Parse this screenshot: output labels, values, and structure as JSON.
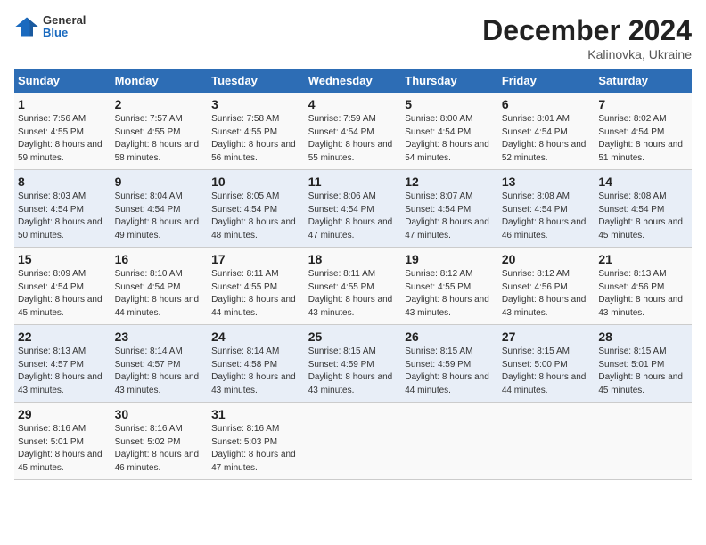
{
  "header": {
    "logo_general": "General",
    "logo_blue": "Blue",
    "month_title": "December 2024",
    "location": "Kalinovka, Ukraine"
  },
  "weekdays": [
    "Sunday",
    "Monday",
    "Tuesday",
    "Wednesday",
    "Thursday",
    "Friday",
    "Saturday"
  ],
  "weeks": [
    [
      {
        "day": "1",
        "sunrise": "Sunrise: 7:56 AM",
        "sunset": "Sunset: 4:55 PM",
        "daylight": "Daylight: 8 hours and 59 minutes."
      },
      {
        "day": "2",
        "sunrise": "Sunrise: 7:57 AM",
        "sunset": "Sunset: 4:55 PM",
        "daylight": "Daylight: 8 hours and 58 minutes."
      },
      {
        "day": "3",
        "sunrise": "Sunrise: 7:58 AM",
        "sunset": "Sunset: 4:55 PM",
        "daylight": "Daylight: 8 hours and 56 minutes."
      },
      {
        "day": "4",
        "sunrise": "Sunrise: 7:59 AM",
        "sunset": "Sunset: 4:54 PM",
        "daylight": "Daylight: 8 hours and 55 minutes."
      },
      {
        "day": "5",
        "sunrise": "Sunrise: 8:00 AM",
        "sunset": "Sunset: 4:54 PM",
        "daylight": "Daylight: 8 hours and 54 minutes."
      },
      {
        "day": "6",
        "sunrise": "Sunrise: 8:01 AM",
        "sunset": "Sunset: 4:54 PM",
        "daylight": "Daylight: 8 hours and 52 minutes."
      },
      {
        "day": "7",
        "sunrise": "Sunrise: 8:02 AM",
        "sunset": "Sunset: 4:54 PM",
        "daylight": "Daylight: 8 hours and 51 minutes."
      }
    ],
    [
      {
        "day": "8",
        "sunrise": "Sunrise: 8:03 AM",
        "sunset": "Sunset: 4:54 PM",
        "daylight": "Daylight: 8 hours and 50 minutes."
      },
      {
        "day": "9",
        "sunrise": "Sunrise: 8:04 AM",
        "sunset": "Sunset: 4:54 PM",
        "daylight": "Daylight: 8 hours and 49 minutes."
      },
      {
        "day": "10",
        "sunrise": "Sunrise: 8:05 AM",
        "sunset": "Sunset: 4:54 PM",
        "daylight": "Daylight: 8 hours and 48 minutes."
      },
      {
        "day": "11",
        "sunrise": "Sunrise: 8:06 AM",
        "sunset": "Sunset: 4:54 PM",
        "daylight": "Daylight: 8 hours and 47 minutes."
      },
      {
        "day": "12",
        "sunrise": "Sunrise: 8:07 AM",
        "sunset": "Sunset: 4:54 PM",
        "daylight": "Daylight: 8 hours and 47 minutes."
      },
      {
        "day": "13",
        "sunrise": "Sunrise: 8:08 AM",
        "sunset": "Sunset: 4:54 PM",
        "daylight": "Daylight: 8 hours and 46 minutes."
      },
      {
        "day": "14",
        "sunrise": "Sunrise: 8:08 AM",
        "sunset": "Sunset: 4:54 PM",
        "daylight": "Daylight: 8 hours and 45 minutes."
      }
    ],
    [
      {
        "day": "15",
        "sunrise": "Sunrise: 8:09 AM",
        "sunset": "Sunset: 4:54 PM",
        "daylight": "Daylight: 8 hours and 45 minutes."
      },
      {
        "day": "16",
        "sunrise": "Sunrise: 8:10 AM",
        "sunset": "Sunset: 4:54 PM",
        "daylight": "Daylight: 8 hours and 44 minutes."
      },
      {
        "day": "17",
        "sunrise": "Sunrise: 8:11 AM",
        "sunset": "Sunset: 4:55 PM",
        "daylight": "Daylight: 8 hours and 44 minutes."
      },
      {
        "day": "18",
        "sunrise": "Sunrise: 8:11 AM",
        "sunset": "Sunset: 4:55 PM",
        "daylight": "Daylight: 8 hours and 43 minutes."
      },
      {
        "day": "19",
        "sunrise": "Sunrise: 8:12 AM",
        "sunset": "Sunset: 4:55 PM",
        "daylight": "Daylight: 8 hours and 43 minutes."
      },
      {
        "day": "20",
        "sunrise": "Sunrise: 8:12 AM",
        "sunset": "Sunset: 4:56 PM",
        "daylight": "Daylight: 8 hours and 43 minutes."
      },
      {
        "day": "21",
        "sunrise": "Sunrise: 8:13 AM",
        "sunset": "Sunset: 4:56 PM",
        "daylight": "Daylight: 8 hours and 43 minutes."
      }
    ],
    [
      {
        "day": "22",
        "sunrise": "Sunrise: 8:13 AM",
        "sunset": "Sunset: 4:57 PM",
        "daylight": "Daylight: 8 hours and 43 minutes."
      },
      {
        "day": "23",
        "sunrise": "Sunrise: 8:14 AM",
        "sunset": "Sunset: 4:57 PM",
        "daylight": "Daylight: 8 hours and 43 minutes."
      },
      {
        "day": "24",
        "sunrise": "Sunrise: 8:14 AM",
        "sunset": "Sunset: 4:58 PM",
        "daylight": "Daylight: 8 hours and 43 minutes."
      },
      {
        "day": "25",
        "sunrise": "Sunrise: 8:15 AM",
        "sunset": "Sunset: 4:59 PM",
        "daylight": "Daylight: 8 hours and 43 minutes."
      },
      {
        "day": "26",
        "sunrise": "Sunrise: 8:15 AM",
        "sunset": "Sunset: 4:59 PM",
        "daylight": "Daylight: 8 hours and 44 minutes."
      },
      {
        "day": "27",
        "sunrise": "Sunrise: 8:15 AM",
        "sunset": "Sunset: 5:00 PM",
        "daylight": "Daylight: 8 hours and 44 minutes."
      },
      {
        "day": "28",
        "sunrise": "Sunrise: 8:15 AM",
        "sunset": "Sunset: 5:01 PM",
        "daylight": "Daylight: 8 hours and 45 minutes."
      }
    ],
    [
      {
        "day": "29",
        "sunrise": "Sunrise: 8:16 AM",
        "sunset": "Sunset: 5:01 PM",
        "daylight": "Daylight: 8 hours and 45 minutes."
      },
      {
        "day": "30",
        "sunrise": "Sunrise: 8:16 AM",
        "sunset": "Sunset: 5:02 PM",
        "daylight": "Daylight: 8 hours and 46 minutes."
      },
      {
        "day": "31",
        "sunrise": "Sunrise: 8:16 AM",
        "sunset": "Sunset: 5:03 PM",
        "daylight": "Daylight: 8 hours and 47 minutes."
      },
      null,
      null,
      null,
      null
    ]
  ]
}
